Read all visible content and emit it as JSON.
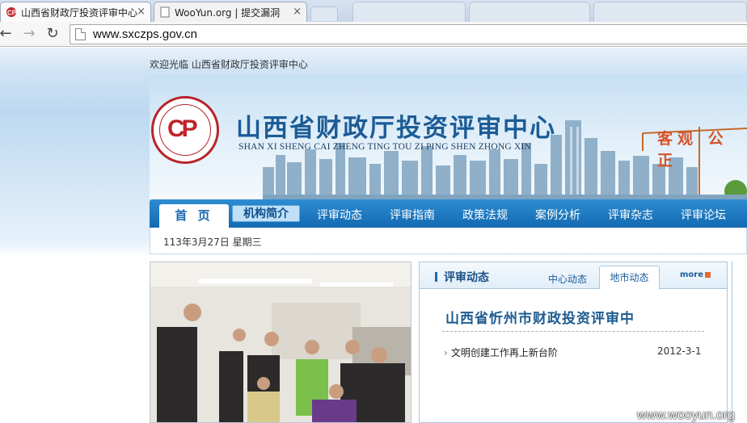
{
  "browser": {
    "tabs": [
      {
        "title": "山西省财政厅投资评审中心"
      },
      {
        "title": "WooYun.org | 提交漏洞"
      }
    ],
    "url": "www.sxczps.gov.cn"
  },
  "site": {
    "welcome": "欢迎光临 山西省财政厅投资评审中心",
    "title_cn": "山西省财政厅投资评审中心",
    "title_pinyin": "SHAN XI SHENG CAI ZHENG TING TOU ZI PING SHEN ZHONG XIN",
    "slogan": "客观 公正"
  },
  "nav": {
    "home": "首 页",
    "items": [
      "机构简介",
      "评审动态",
      "评审指南",
      "政策法规",
      "案例分析",
      "评审杂志",
      "评审论坛"
    ]
  },
  "datebar": {
    "date": "113年3月27日 星期三"
  },
  "news": {
    "title": "评审动态",
    "tabs": [
      "中心动态",
      "地市动态"
    ],
    "more": "more",
    "headline": "山西省忻州市财政投资评审中",
    "items": [
      {
        "title": "文明创建工作再上新台阶",
        "date": "2012-3-1"
      }
    ]
  },
  "watermark": "www.wooyun.org"
}
